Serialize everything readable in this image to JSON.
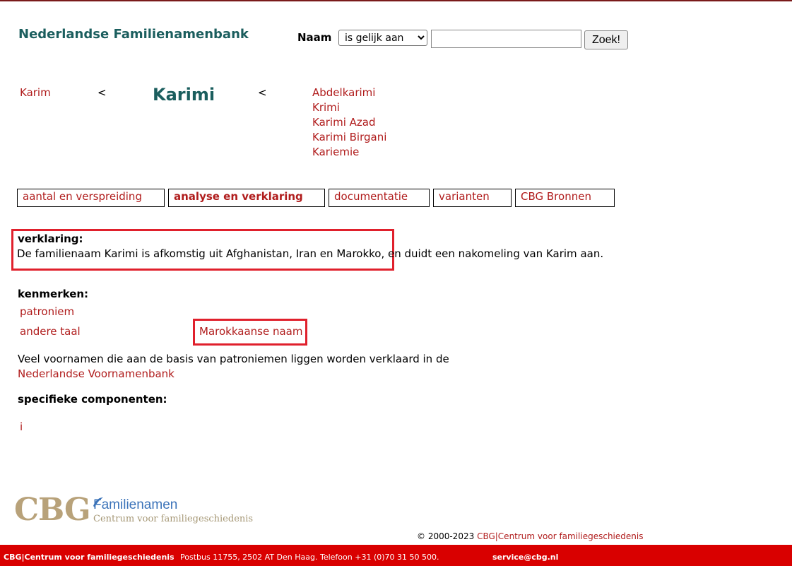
{
  "header": {
    "site_title": "Nederlandse Familienamenbank",
    "search_label": "Naam",
    "search_mode": "is gelijk aan",
    "search_value": "",
    "search_button": "Zoek!"
  },
  "name_nav": {
    "previous": "Karim",
    "arrow_left": "<",
    "current": "Karimi",
    "arrow_right": "<",
    "variants": [
      "Abdelkarimi",
      "Krimi",
      "Karimi Azad",
      "Karimi Birgani",
      "Kariemie"
    ]
  },
  "tabs": [
    {
      "label": "aantal en verspreiding",
      "active": false
    },
    {
      "label": "analyse en verklaring",
      "active": true
    },
    {
      "label": "documentatie",
      "active": false
    },
    {
      "label": "varianten",
      "active": false
    },
    {
      "label": "CBG Bronnen",
      "active": false
    }
  ],
  "verklaring": {
    "label": "verklaring:",
    "text": "De familienaam Karimi is afkomstig uit Afghanistan, Iran en Marokko, en duidt een nakomeling van Karim aan."
  },
  "kenmerken": {
    "label": "kenmerken:",
    "items": [
      "patroniem",
      "andere taal",
      "Marokkaanse naam"
    ]
  },
  "note": {
    "text": "Veel voornamen die aan de basis van patroniemen liggen worden verklaard in de",
    "link": "Nederlandse Voornamenbank"
  },
  "components": {
    "label": "specifieke componenten:",
    "items": [
      "i"
    ]
  },
  "logo": {
    "mark": "CBG",
    "line1": "Familienamen",
    "line2": "Centrum voor familiegeschiedenis"
  },
  "copyright": {
    "text": "© 2000-2023",
    "link": "CBG|Centrum voor familiegeschiedenis"
  },
  "footer": {
    "org": "CBG|Centrum voor familiegeschiedenis",
    "address": "Postbus 11755, 2502 AT Den Haag. Telefoon +31 (0)70 31 50 500.",
    "email": "service@cbg.nl"
  },
  "colors": {
    "accent_teal": "#1b5e5e",
    "link_red": "#b01c1c",
    "highlight": "#e0202c",
    "footer_bg": "#d90000"
  }
}
